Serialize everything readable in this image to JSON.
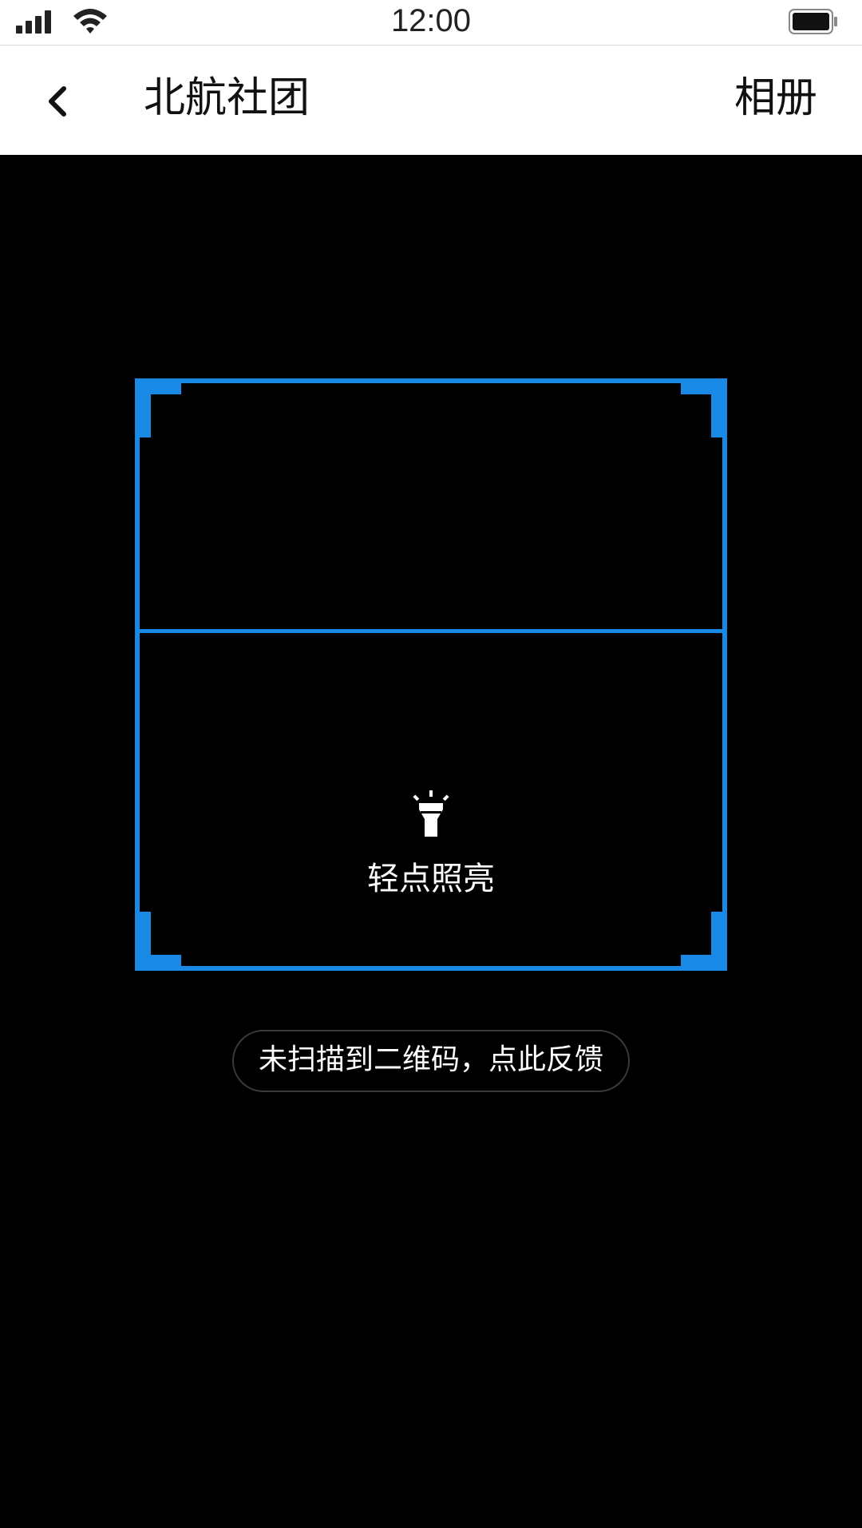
{
  "status_bar": {
    "time": "12:00",
    "signal_icon": "signal-icon",
    "wifi_icon": "wifi-icon",
    "battery_icon": "battery-icon"
  },
  "nav": {
    "back_icon": "chevron-left-icon",
    "title": "北航社团",
    "album_label": "相册"
  },
  "scanner": {
    "frame_color": "#1a88e5",
    "flashlight_icon": "flashlight-icon",
    "flashlight_label": "轻点照亮"
  },
  "feedback": {
    "label": "未扫描到二维码，点此反馈"
  }
}
